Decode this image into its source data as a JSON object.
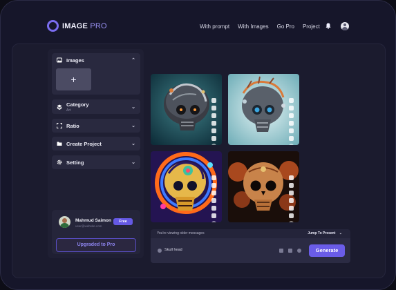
{
  "brand": {
    "name": "IMAGE",
    "suffix": "PRO",
    "accent": "#7b6df0"
  },
  "nav": {
    "items": [
      "With prompt",
      "With Images",
      "Go Pro",
      "Project"
    ]
  },
  "header_icons": [
    "bell-icon",
    "user-avatar-icon"
  ],
  "sidebar": {
    "sections": [
      {
        "label": "Images",
        "icon": "image-icon",
        "expanded": true,
        "chevron": "⌃"
      },
      {
        "label": "Category",
        "sub": "Art",
        "icon": "layers-icon",
        "chevron": "⌄"
      },
      {
        "label": "Ratio",
        "icon": "aspect-ratio-icon",
        "chevron": "⌄"
      },
      {
        "label": "Create Project",
        "icon": "folder-icon",
        "chevron": "⌄"
      },
      {
        "label": "Setting",
        "icon": "gear-icon",
        "chevron": "⌄"
      }
    ],
    "add_button": "+"
  },
  "user": {
    "name": "Mahmud Saimon",
    "email": "user@website.com",
    "plan": "Free",
    "upgrade_label": "Upgraded to Pro"
  },
  "gallery": {
    "images": [
      {
        "name": "skull-mechanical-teal"
      },
      {
        "name": "skull-mechanical-blue"
      },
      {
        "name": "skull-psychedelic"
      },
      {
        "name": "skull-floral-orange"
      }
    ],
    "tool_icons": [
      "close-icon",
      "copy-icon",
      "edit-icon",
      "share-icon",
      "folder-icon",
      "heart-icon",
      "more-icon"
    ]
  },
  "chat": {
    "notice": "You're viewing older messages",
    "jump": "Jump To Present",
    "jump_chevron": "⌄"
  },
  "prompt": {
    "value": "Skull head",
    "generate_label": "Generate"
  }
}
